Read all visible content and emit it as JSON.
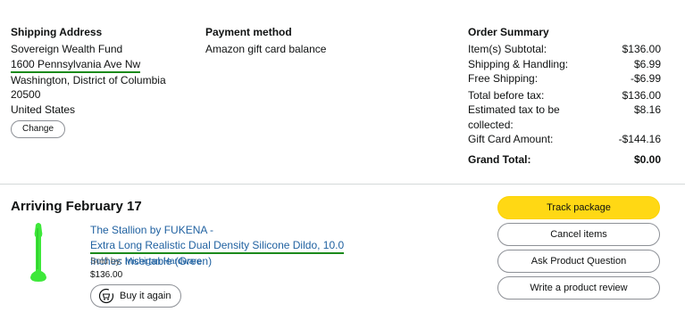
{
  "shipping": {
    "heading": "Shipping Address",
    "name": "Sovereign Wealth Fund",
    "street": "1600 Pennsylvania Ave Nw",
    "city": "Washington, District of Columbia",
    "zip": "20500",
    "country": "United States",
    "change_label": "Change"
  },
  "payment": {
    "heading": "Payment method",
    "method": "Amazon gift card balance"
  },
  "summary": {
    "heading": "Order Summary",
    "items_label": "Item(s) Subtotal:",
    "items_value": "$136.00",
    "shipping_label": "Shipping & Handling:",
    "shipping_value": "$6.99",
    "free_label": "Free Shipping:",
    "free_value": "-$6.99",
    "before_tax_label": "Total before tax:",
    "before_tax_value": "$136.00",
    "tax_label": "Estimated tax to be collected:",
    "tax_value": "$8.16",
    "gift_label": "Gift Card Amount:",
    "gift_value": "-$144.16",
    "grand_label": "Grand Total:",
    "grand_value": "$0.00"
  },
  "shipment": {
    "arriving": "Arriving February 17",
    "title_part1": "The Stallion by FUKENA - ",
    "title_part2": "Extra Long Realistic Dual Density Silicone Dildo, 10.0",
    "title_part3": "Inches Insertable (Green)",
    "sold_by_label": "Sold by: ",
    "seller": "Michigan Hardware",
    "price": "$136.00",
    "buy_again_label": "Buy it again"
  },
  "actions": {
    "track": "Track package",
    "cancel": "Cancel items",
    "ask": "Ask Product Question",
    "review": "Write a product review"
  },
  "colors": {
    "primary_button": "#ffd814",
    "link": "#2162a1",
    "highlight_underline": "#1b8a1b"
  }
}
